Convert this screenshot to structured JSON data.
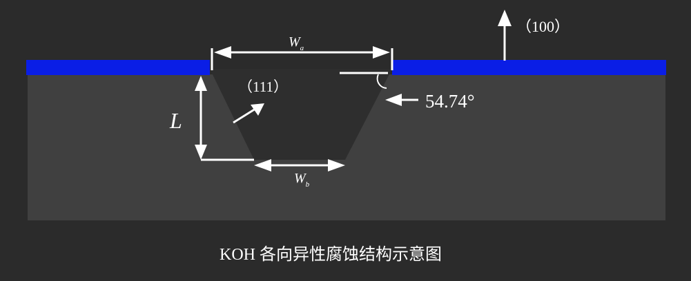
{
  "diagram": {
    "caption": "KOH 各向异性腐蚀结构示意图",
    "labels": {
      "wa_main": "W",
      "wa_sub": "a",
      "wb_main": "W",
      "wb_sub": "b",
      "depth": "L",
      "plane_111": "（111）",
      "plane_100": "（100）",
      "angle": "54.74°"
    },
    "colors": {
      "background": "#2b2b2b",
      "substrate": "#404040",
      "mask": "#0a1ee6",
      "pit": "#2e2e2e",
      "annotation": "#ffffff"
    }
  }
}
